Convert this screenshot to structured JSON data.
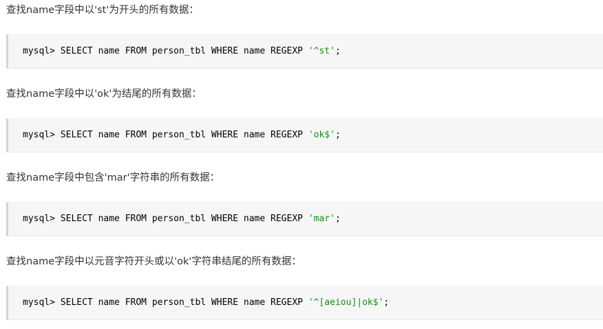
{
  "sections": [
    {
      "description": "查找name字段中以'st'为开头的所有数据：",
      "code_prefix": "mysql> SELECT name FROM person_tbl WHERE name REGEXP ",
      "code_string": "'^st'",
      "code_suffix": ";"
    },
    {
      "description": "查找name字段中以'ok'为结尾的所有数据：",
      "code_prefix": "mysql> SELECT name FROM person_tbl WHERE name REGEXP ",
      "code_string": "'ok$'",
      "code_suffix": ";"
    },
    {
      "description": "查找name字段中包含'mar'字符串的所有数据：",
      "code_prefix": "mysql> SELECT name FROM person_tbl WHERE name REGEXP ",
      "code_string": "'mar'",
      "code_suffix": ";"
    },
    {
      "description": "查找name字段中以元音字符开头或以'ok'字符串结尾的所有数据：",
      "code_prefix": "mysql> SELECT name FROM person_tbl WHERE name REGEXP ",
      "code_string": "'^[aeiou]|ok$'",
      "code_suffix": ";"
    }
  ],
  "colors": {
    "text": "#333333",
    "code_background": "#f6f6f6",
    "code_border": "#d4d4d4",
    "string_literal": "#1a8a1a"
  }
}
